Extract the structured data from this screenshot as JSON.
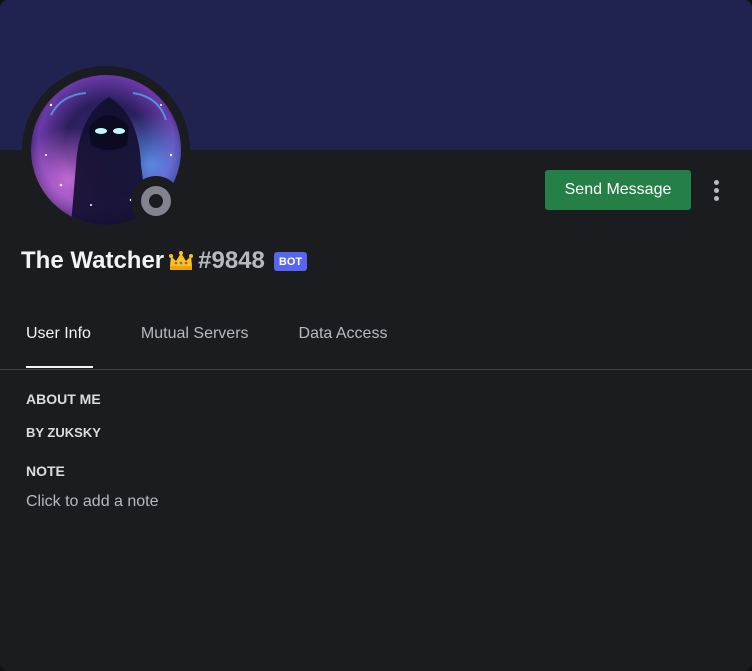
{
  "profile": {
    "username": "The Watcher",
    "crown_emoji": "👑",
    "discriminator": "#9848",
    "bot_tag": "BOT",
    "status": "offline",
    "avatar_icon": "cosmic-avatar-icon"
  },
  "actions": {
    "send_message_label": "Send Message",
    "more_icon": "more-vertical-icon"
  },
  "tabs": [
    {
      "label": "User Info",
      "active": true
    },
    {
      "label": "Mutual Servers",
      "active": false
    },
    {
      "label": "Data Access",
      "active": false
    }
  ],
  "about": {
    "heading": "ABOUT ME",
    "text": "BY ZUKSKY"
  },
  "note": {
    "heading": "NOTE",
    "placeholder": "Click to add a note"
  },
  "colors": {
    "banner": "#202350",
    "card": "#1b1c20",
    "send_button": "#248046",
    "bot_tag": "#5865f2",
    "status_offline": "#80848e"
  }
}
